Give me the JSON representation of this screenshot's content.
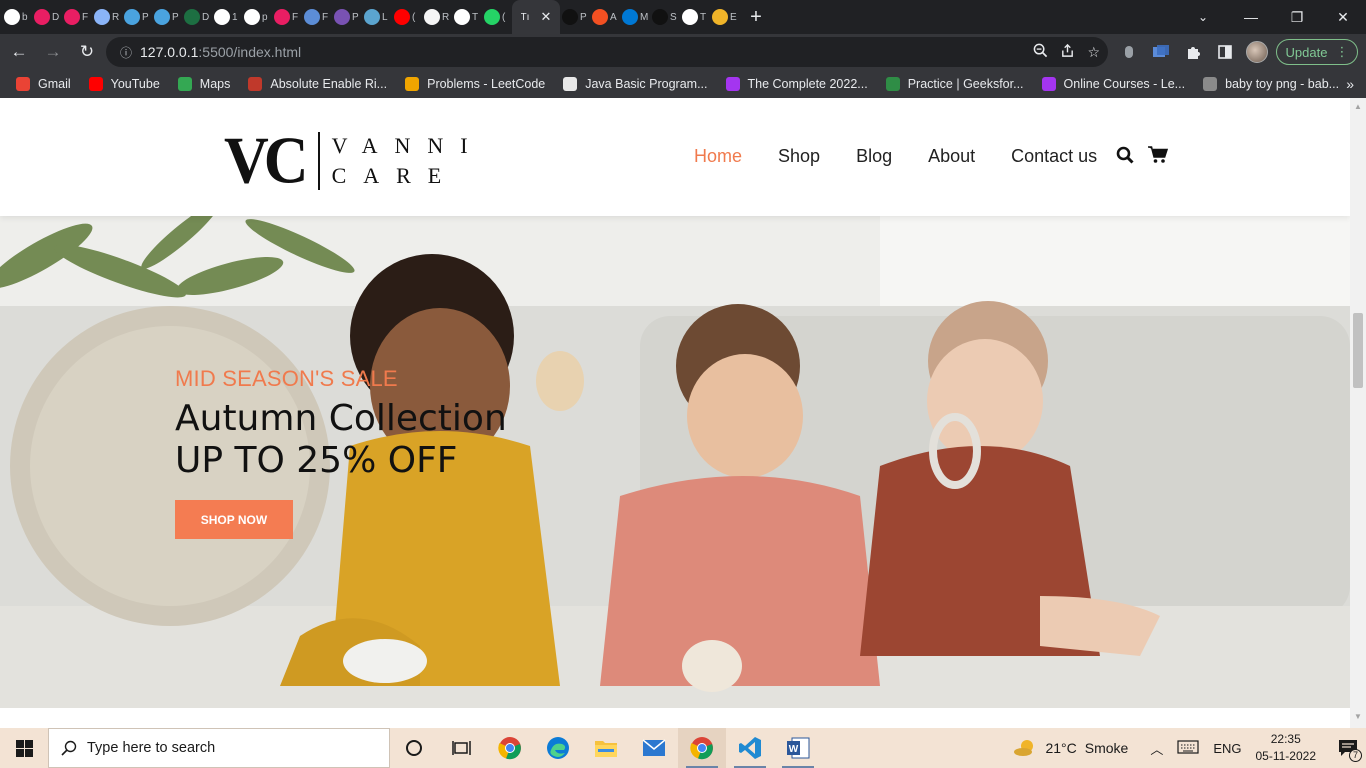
{
  "browser": {
    "tabs": [
      {
        "icon": "google-icon",
        "letter": "b",
        "color": "#ffffff"
      },
      {
        "icon": "favicon-pink-drop-icon",
        "letter": "D",
        "color": "#e91e63"
      },
      {
        "icon": "favicon-pink-drop-icon",
        "letter": "F",
        "color": "#e91e63"
      },
      {
        "icon": "gear-favicon-icon",
        "letter": "R",
        "color": "#8ab4f8"
      },
      {
        "icon": "webflow-icon",
        "letter": "P",
        "color": "#4aa3df"
      },
      {
        "icon": "webflow-icon",
        "letter": "P",
        "color": "#4aa3df"
      },
      {
        "icon": "excel-icon",
        "letter": "D",
        "color": "#1d6f42"
      },
      {
        "icon": "github-user-icon",
        "letter": "1",
        "color": "#ffffff"
      },
      {
        "icon": "google-icon",
        "letter": "p",
        "color": "#ffffff"
      },
      {
        "icon": "favicon-pink-drop-icon",
        "letter": "F",
        "color": "#e91e63"
      },
      {
        "icon": "flag-icon",
        "letter": "F",
        "color": "#5c8dd6"
      },
      {
        "icon": "bootstrap-icon",
        "letter": "P",
        "color": "#7952b3"
      },
      {
        "icon": "coding-ninjas-icon",
        "letter": "L",
        "color": "#5ba4cf"
      },
      {
        "icon": "youtube-icon",
        "letter": "(",
        "color": "#ff0000"
      },
      {
        "icon": "page-icon",
        "letter": "R",
        "color": "#f5f5f5"
      },
      {
        "icon": "globe-icon",
        "letter": "T",
        "color": "#ffffff"
      },
      {
        "icon": "whatsapp-icon",
        "letter": "(",
        "color": "#25d366"
      },
      {
        "icon": "active-tab",
        "letter": "Tı",
        "color": "#35363a"
      },
      {
        "icon": "github-icon",
        "letter": "P",
        "color": "#111111"
      },
      {
        "icon": "microsoft-icon",
        "letter": "A",
        "color": "#f25022"
      },
      {
        "icon": "outlook-icon",
        "letter": "M",
        "color": "#0078d4"
      },
      {
        "icon": "github-icon",
        "letter": "S",
        "color": "#111111"
      },
      {
        "icon": "globe-icon",
        "letter": "T",
        "color": "#ffffff"
      },
      {
        "icon": "eslint-icon",
        "letter": "E",
        "color": "#f0b429"
      }
    ],
    "new_tab_label": "+",
    "url_host": "127.0.0.1",
    "url_rest": ":5500/index.html",
    "update_label": "Update",
    "bookmarks": [
      {
        "label": "Gmail",
        "color": "#ea4335"
      },
      {
        "label": "YouTube",
        "color": "#ff0000"
      },
      {
        "label": "Maps",
        "color": "#34a853"
      },
      {
        "label": "Absolute Enable Ri...",
        "color": "#c0392b"
      },
      {
        "label": "Problems - LeetCode",
        "color": "#f0a500"
      },
      {
        "label": "Java Basic Program...",
        "color": "#e8e8e8"
      },
      {
        "label": "The Complete 2022...",
        "color": "#a435f0"
      },
      {
        "label": "Practice | Geeksfor...",
        "color": "#2f8d46"
      },
      {
        "label": "Online Courses - Le...",
        "color": "#a435f0"
      },
      {
        "label": "baby toy png - bab...",
        "color": "#8a8a8a"
      }
    ],
    "bookmarks_more": "»"
  },
  "site": {
    "logo": {
      "mark": "VC",
      "line1": "VANNI",
      "line2": "CARE"
    },
    "nav": [
      "Home",
      "Shop",
      "Blog",
      "About",
      "Contact us"
    ],
    "hero": {
      "eyebrow": "MID SEASON'S SALE",
      "title_line1": "Autumn Collection",
      "title_line2": "UP TO 25% OFF",
      "cta": "SHOP NOW"
    },
    "colors": {
      "accent": "#f47c52",
      "text": "#111111"
    }
  },
  "taskbar": {
    "search_placeholder": "Type here to search",
    "weather": {
      "temp": "21°C",
      "condition": "Smoke"
    },
    "language": "ENG",
    "time": "22:35",
    "date": "05-11-2022",
    "notification_count": "7"
  }
}
